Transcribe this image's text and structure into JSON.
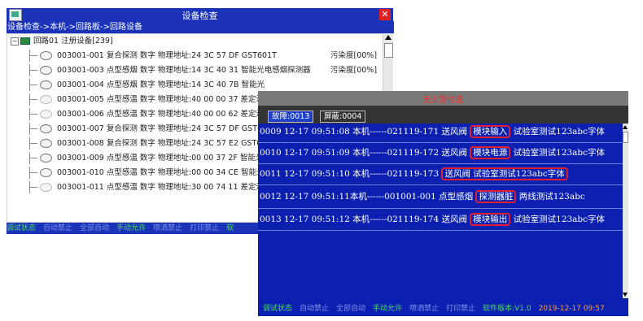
{
  "main_window": {
    "title": "设备检查",
    "close_glyph": "✕",
    "breadcrumb": "设备检查->本机->回路板->回路设备",
    "tree_root": {
      "toggle": "−",
      "label": "回路01 注册设备[239]"
    },
    "tree_rows": [
      {
        "text": "003001-001 复合探测 数字 物理地址:24 3C 57 DF  GST601T",
        "extra": "污染度[00%]"
      },
      {
        "text": "003001-003 点型感烟 数字 物理地址:14 3C 40 31 智能光电感烟探测器",
        "extra": "污染度[00%]"
      },
      {
        "text": "003001-004 点型感烟 数字 物理地址:14 3C 40 7B 智能光",
        "extra": ""
      },
      {
        "text": "003001-005 点型感温 数字 物理地址:40 00 00 37 差定温",
        "extra": ""
      },
      {
        "text": "003001-006 点型感温 数字 物理地址:40 00 00 62 差定温",
        "extra": ""
      },
      {
        "text": "003001-007 复合探测 数字 物理地址:24 3C 57 DF  GST6",
        "extra": ""
      },
      {
        "text": "003001-008 复合探测 数字 物理地址:24 3C 57 E2  GST6",
        "extra": ""
      },
      {
        "text": "003001-009 点型感温 数字 物理地址:00 00 37 2F 智能光",
        "extra": ""
      },
      {
        "text": "003001-010 点型感温 数字 物理地址:00 00 34 CE 智能光",
        "extra": ""
      },
      {
        "text": "003001-011 点型感温 数字 物理地址:30 00 74 11 差定温",
        "extra": ""
      }
    ],
    "status": [
      "调试状态",
      "自动禁止",
      "全部自动",
      "手动允许",
      "喷洒禁止",
      "打印禁止",
      "软"
    ]
  },
  "alarm_window": {
    "title": "无火警信息",
    "tabs": [
      "故障:0013",
      "屏蔽:0004"
    ],
    "rows": [
      {
        "pre": "0009 12-17 09:51:08 本机------021119-171 送风阀 ",
        "hl": "模块输入",
        "post": " 试验室测试123abc字体"
      },
      {
        "pre": "0010 12-17 09:51:09 本机------021119-172 送风阀 ",
        "hl": "模块电源",
        "post": " 试验室测试123abc字体"
      },
      {
        "pre": "0011 12-17 09:51:10 本机------021119-173 ",
        "hl": "送风阀 试验室测试123abc字体",
        "post": ""
      },
      {
        "pre": "0012 12-17 09:51:11本机------001001-001 点型感烟 ",
        "hl": "探测器脏",
        "post": " 两线测试123abc"
      },
      {
        "pre": "0013 12-17 09:51:12 本机------021119-174 送风阀 ",
        "hl": "模块输出",
        "post": " 试验室测试123abc字体"
      }
    ],
    "status": [
      "调试状态",
      "自动禁止",
      "全部自动",
      "手动允许",
      "喷洒禁止",
      "打印禁止",
      "软件版本:V1.0",
      "2019-12-17 09:57"
    ]
  },
  "colors": {
    "titlebar_blue": "#1a33b8",
    "panel_blue": "#0b20b0",
    "highlight_red": "#e02030",
    "status_green": "#4cd964",
    "status_orange": "#ff9d2e"
  }
}
